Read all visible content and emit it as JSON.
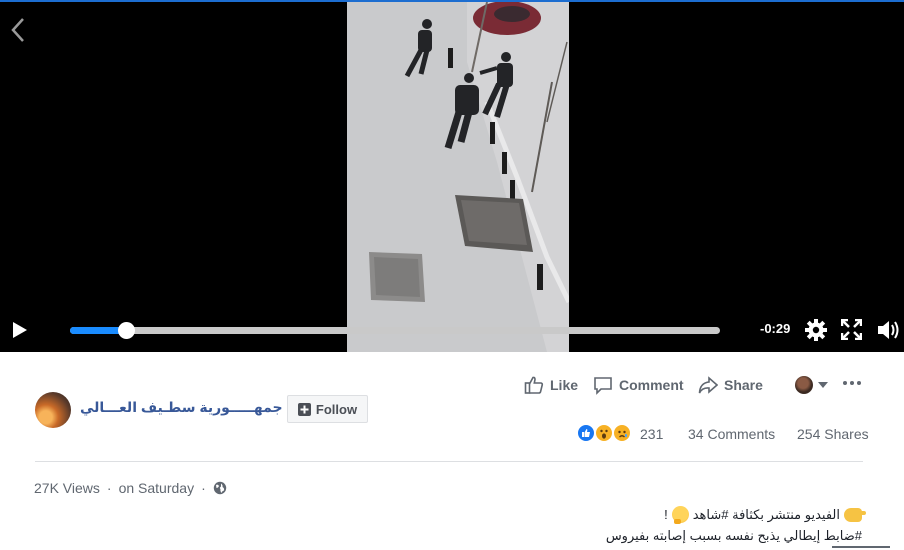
{
  "video": {
    "time_remaining": "-0:29",
    "progress_fraction": 0.086
  },
  "actions": {
    "like_label": "Like",
    "comment_label": "Comment",
    "share_label": "Share"
  },
  "page": {
    "name": "جمهـــــورية سطـيف العـــالي",
    "follow_label": "Follow"
  },
  "stats": {
    "reaction_count": "231",
    "comments": "34 Comments",
    "shares": "254 Shares"
  },
  "meta": {
    "views": "27K Views",
    "separator": "·",
    "date": "on Saturday"
  },
  "description": {
    "line1": "الفيديو منتشر بكثافة #شاهد",
    "line1_suffix": "!",
    "line2": "#ضابط إيطالي يذبح نفسه بسبب إصابته بفيروس"
  },
  "icons": {
    "back": "chevron-left-icon",
    "play": "play-icon",
    "settings": "gear-icon",
    "fullscreen": "expand-icon",
    "volume": "speaker-icon",
    "like": "thumbs-up-icon",
    "comment": "speech-bubble-icon",
    "share": "share-arrow-icon",
    "more": "ellipsis-icon",
    "follow": "follow-plus-icon",
    "privacy": "globe-icon"
  },
  "colors": {
    "link_blue": "#385898",
    "progress_blue": "#1a8cff",
    "reaction_like": "#1877f2",
    "muted_text": "#606770"
  }
}
